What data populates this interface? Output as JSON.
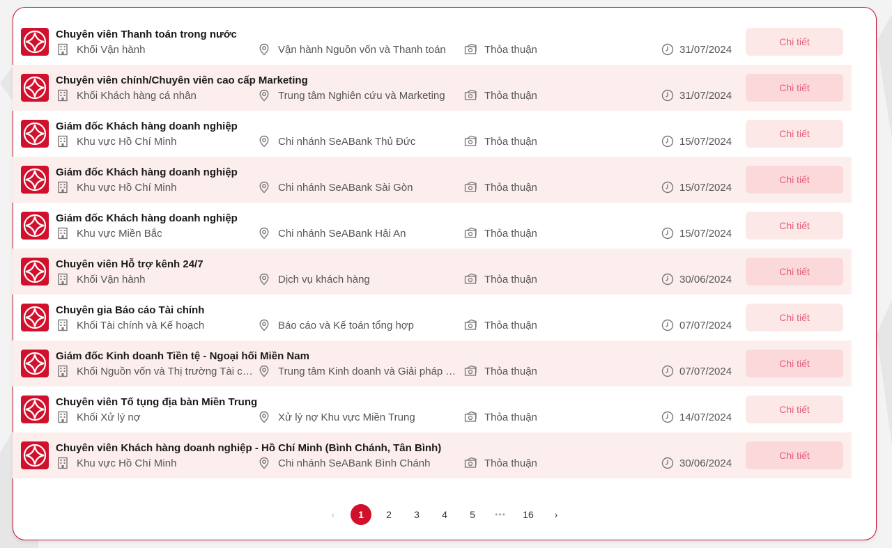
{
  "jobs": [
    {
      "title": "Chuyên viên Thanh toán trong nước",
      "department": "Khối Vận hành",
      "location": "Vận hành Nguồn vốn và Thanh toán",
      "salary": "Thỏa thuận",
      "deadline": "31/07/2024",
      "button": "Chi tiết"
    },
    {
      "title": "Chuyên viên chính/Chuyên viên cao cấp Marketing",
      "department": "Khối Khách hàng cá nhân",
      "location": "Trung tâm Nghiên cứu và Marketing",
      "salary": "Thỏa thuận",
      "deadline": "31/07/2024",
      "button": "Chi tiết"
    },
    {
      "title": "Giám đốc Khách hàng doanh nghiệp",
      "department": "Khu vực Hồ Chí Minh",
      "location": "Chi nhánh SeABank Thủ Đức",
      "salary": "Thỏa thuận",
      "deadline": "15/07/2024",
      "button": "Chi tiết"
    },
    {
      "title": "Giám đốc Khách hàng doanh nghiệp",
      "department": "Khu vực Hồ Chí Minh",
      "location": "Chi nhánh SeABank Sài Gòn",
      "salary": "Thỏa thuận",
      "deadline": "15/07/2024",
      "button": "Chi tiết"
    },
    {
      "title": "Giám đốc Khách hàng doanh nghiệp",
      "department": "Khu vực Miền Bắc",
      "location": "Chi nhánh SeABank Hải An",
      "salary": "Thỏa thuận",
      "deadline": "15/07/2024",
      "button": "Chi tiết"
    },
    {
      "title": "Chuyên viên Hỗ trợ kênh 24/7",
      "department": "Khối Vận hành",
      "location": "Dịch vụ khách hàng",
      "salary": "Thỏa thuận",
      "deadline": "30/06/2024",
      "button": "Chi tiết"
    },
    {
      "title": "Chuyên gia Báo cáo Tài chính",
      "department": "Khối Tài chính và Kế hoạch",
      "location": "Báo cáo và Kế toán tổng hợp",
      "salary": "Thỏa thuận",
      "deadline": "07/07/2024",
      "button": "Chi tiết"
    },
    {
      "title": "Giám đốc Kinh doanh Tiền tệ - Ngoại hối Miền Nam",
      "department": "Khối Nguồn vốn và Thị trường Tài chính",
      "location": "Trung tâm Kinh doanh và Giải pháp Tiền tệ",
      "salary": "Thỏa thuận",
      "deadline": "07/07/2024",
      "button": "Chi tiết"
    },
    {
      "title": "Chuyên viên Tố tụng địa bàn Miền Trung",
      "department": "Khối Xử lý nợ",
      "location": "Xử lý nợ Khu vực Miền Trung",
      "salary": "Thỏa thuận",
      "deadline": "14/07/2024",
      "button": "Chi tiết"
    },
    {
      "title": "Chuyên viên Khách hàng doanh nghiệp - Hồ Chí Minh (Bình Chánh, Tân Bình)",
      "department": "Khu vực Hồ Chí Minh",
      "location": "Chi nhánh SeABank Bình Chánh",
      "salary": "Thỏa thuận",
      "deadline": "30/06/2024",
      "button": "Chi tiết"
    }
  ],
  "pagination": {
    "prev": "‹",
    "pages": [
      "1",
      "2",
      "3",
      "4",
      "5"
    ],
    "ellipsis": "•••",
    "last": "16",
    "next": "›",
    "current": "1"
  },
  "colors": {
    "brand": "#d0102d",
    "row_alt": "#fdeeee",
    "button_bg": "#fde8e8",
    "button_text": "#e0607a"
  },
  "icons": {
    "logo": "seabank-logo",
    "department": "building-icon",
    "location": "map-pin-icon",
    "salary": "money-icon",
    "deadline": "clock-icon"
  }
}
